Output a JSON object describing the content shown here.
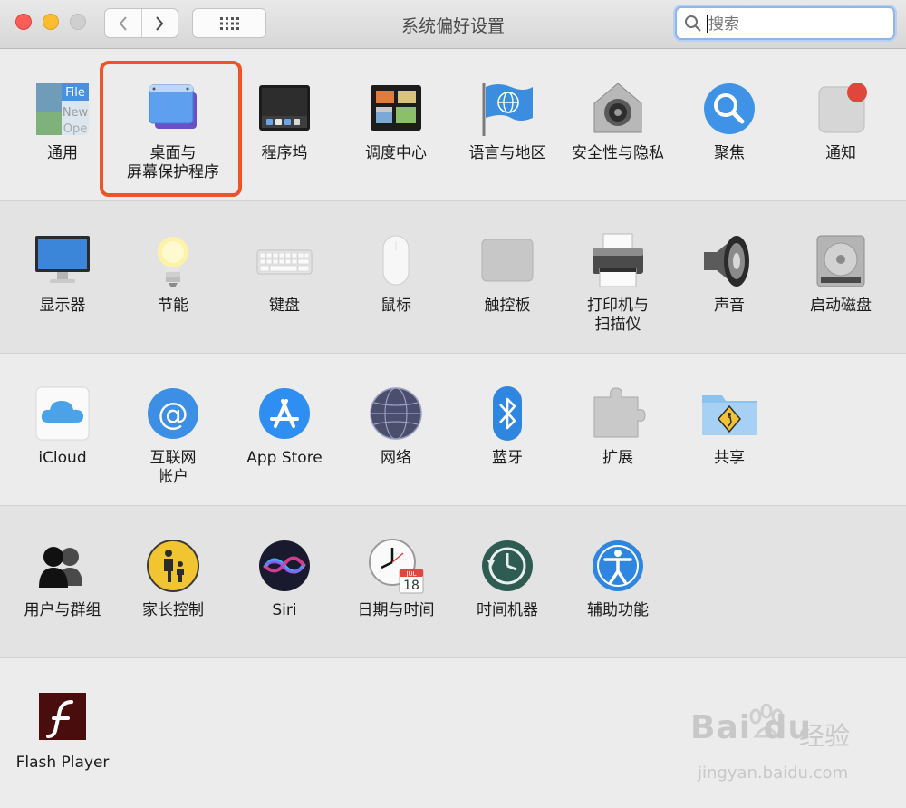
{
  "window": {
    "title": "系统偏好设置"
  },
  "search": {
    "placeholder": "搜索",
    "value": ""
  },
  "rows": [
    [
      {
        "label": "通用",
        "icon": "general-icon"
      },
      {
        "label": "桌面与\n屏幕保护程序",
        "icon": "desktop-screensaver-icon",
        "highlighted": true
      },
      {
        "label": "程序坞",
        "icon": "dock-icon"
      },
      {
        "label": "调度中心",
        "icon": "mission-control-icon"
      },
      {
        "label": "语言与地区",
        "icon": "language-region-icon"
      },
      {
        "label": "安全性与隐私",
        "icon": "security-privacy-icon"
      },
      {
        "label": "聚焦",
        "icon": "spotlight-icon"
      },
      {
        "label": "通知",
        "icon": "notifications-icon"
      }
    ],
    [
      {
        "label": "显示器",
        "icon": "displays-icon"
      },
      {
        "label": "节能",
        "icon": "energy-saver-icon"
      },
      {
        "label": "键盘",
        "icon": "keyboard-icon"
      },
      {
        "label": "鼠标",
        "icon": "mouse-icon"
      },
      {
        "label": "触控板",
        "icon": "trackpad-icon"
      },
      {
        "label": "打印机与\n扫描仪",
        "icon": "printer-icon"
      },
      {
        "label": "声音",
        "icon": "sound-icon"
      },
      {
        "label": "启动磁盘",
        "icon": "startup-disk-icon"
      }
    ],
    [
      {
        "label": "iCloud",
        "icon": "icloud-icon"
      },
      {
        "label": "互联网\n帐户",
        "icon": "internet-accounts-icon"
      },
      {
        "label": "App Store",
        "icon": "app-store-icon"
      },
      {
        "label": "网络",
        "icon": "network-icon"
      },
      {
        "label": "蓝牙",
        "icon": "bluetooth-icon"
      },
      {
        "label": "扩展",
        "icon": "extensions-icon"
      },
      {
        "label": "共享",
        "icon": "sharing-icon"
      }
    ],
    [
      {
        "label": "用户与群组",
        "icon": "users-groups-icon"
      },
      {
        "label": "家长控制",
        "icon": "parental-controls-icon"
      },
      {
        "label": "Siri",
        "icon": "siri-icon"
      },
      {
        "label": "日期与时间",
        "icon": "date-time-icon"
      },
      {
        "label": "时间机器",
        "icon": "time-machine-icon"
      },
      {
        "label": "辅助功能",
        "icon": "accessibility-icon"
      }
    ],
    [
      {
        "label": "Flash Player",
        "icon": "flash-player-icon"
      }
    ]
  ],
  "icon_text": {
    "general_file": "File",
    "general_new": "New",
    "general_open": "Ope",
    "calendar_month": "JUL",
    "calendar_day": "18"
  },
  "watermark": {
    "brand": "Bai du",
    "name": "经验",
    "url": "jingyan.baidu.com"
  },
  "colors": {
    "highlight": "#f05426",
    "search_focus": "#8fb6ea"
  }
}
